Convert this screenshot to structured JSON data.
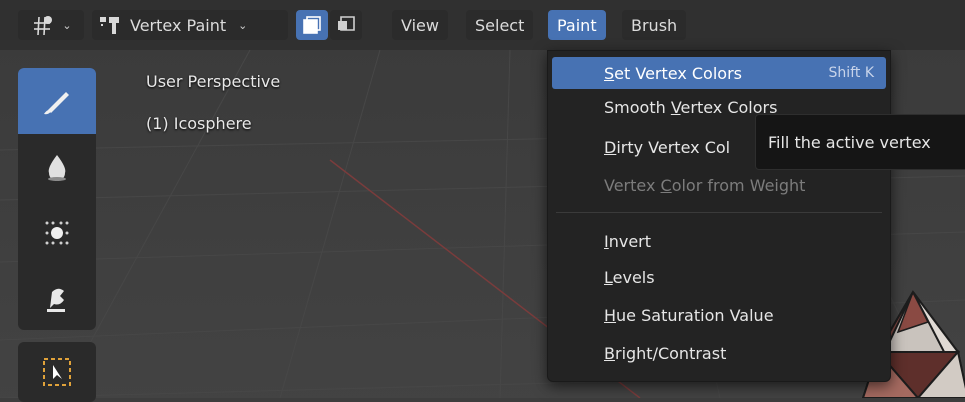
{
  "header": {
    "mode_label": "Vertex Paint",
    "menus": [
      {
        "label": "View"
      },
      {
        "label": "Select"
      },
      {
        "label": "Paint",
        "active": true
      },
      {
        "label": "Brush"
      }
    ]
  },
  "viewport": {
    "perspective_label": "User Perspective",
    "object_label": "(1) Icosphere"
  },
  "toolbar": {
    "tools": [
      "draw-brush-icon",
      "blur-drop-icon",
      "average-dots-icon",
      "smear-icon",
      "box-select-icon"
    ],
    "active_tool": "draw-brush-icon"
  },
  "paint_menu": {
    "items": [
      {
        "label": "Set Vertex Colors",
        "mnemonic": "S",
        "shortcut": "Shift K",
        "highlighted": true
      },
      {
        "label": "Smooth Vertex Colors",
        "mnemonic": "V"
      },
      {
        "label": "Dirty Vertex Col",
        "mnemonic": "D"
      },
      {
        "label": "Vertex Color from Weight",
        "mnemonic": "C",
        "disabled": true
      },
      {
        "label": "Invert",
        "mnemonic": "I"
      },
      {
        "label": "Levels",
        "mnemonic": "L"
      },
      {
        "label": "Hue Saturation Value",
        "mnemonic": "H"
      },
      {
        "label": "Bright/Contrast",
        "mnemonic": "B"
      }
    ]
  },
  "tooltip": {
    "text": "Fill the active vertex"
  },
  "colors": {
    "accent": "#4772b3",
    "header_bg": "#303030",
    "menu_bg": "#232323",
    "viewport_bg": "#3f3f3f"
  }
}
